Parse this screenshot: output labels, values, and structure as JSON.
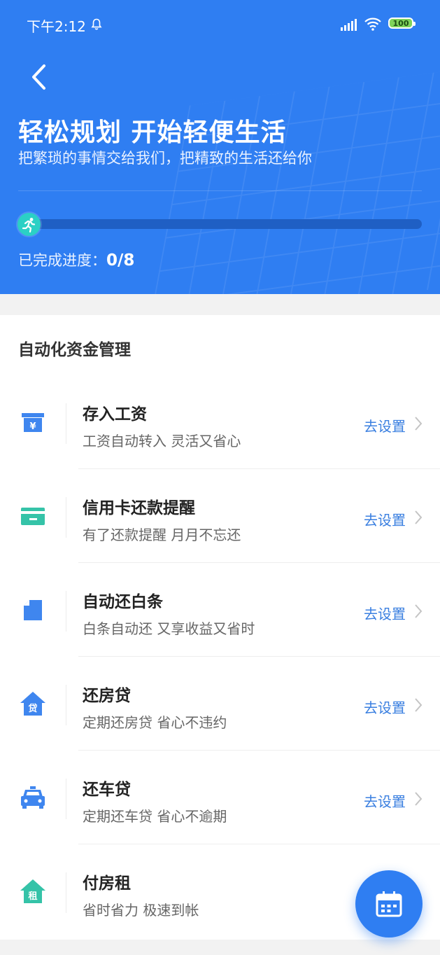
{
  "status_bar": {
    "time": "下午2:12",
    "battery": "100"
  },
  "header": {
    "title": "轻松规划 开始轻便生活",
    "subtitle": "把繁琐的事情交给我们，把精致的生活还给你",
    "progress_label": "已完成进度：",
    "progress_value": "0/8",
    "progress_fraction": 0.0
  },
  "section": {
    "title": "自动化资金管理"
  },
  "items": [
    {
      "title": "存入工资",
      "desc": "工资自动转入 灵活又省心",
      "action": "去设置",
      "icon": "salary-box-icon",
      "color": "#3f86ef"
    },
    {
      "title": "信用卡还款提醒",
      "desc": "有了还款提醒 月月不忘还",
      "action": "去设置",
      "icon": "credit-card-icon",
      "color": "#35c3a8"
    },
    {
      "title": "自动还白条",
      "desc": "白条自动还 又享收益又省时",
      "action": "去设置",
      "icon": "document-icon",
      "color": "#3f86ef"
    },
    {
      "title": "还房贷",
      "desc": "定期还房贷 省心不违约",
      "action": "去设置",
      "icon": "house-loan-icon",
      "color": "#3f86ef",
      "glyph": "贷"
    },
    {
      "title": "还车贷",
      "desc": "定期还车贷 省心不逾期",
      "action": "去设置",
      "icon": "car-icon",
      "color": "#3f86ef"
    },
    {
      "title": "付房租",
      "desc": "省时省力 极速到帐",
      "action": "",
      "icon": "house-rent-icon",
      "color": "#35c3a8",
      "glyph": "租"
    }
  ],
  "fab": {
    "icon": "calendar-icon"
  }
}
